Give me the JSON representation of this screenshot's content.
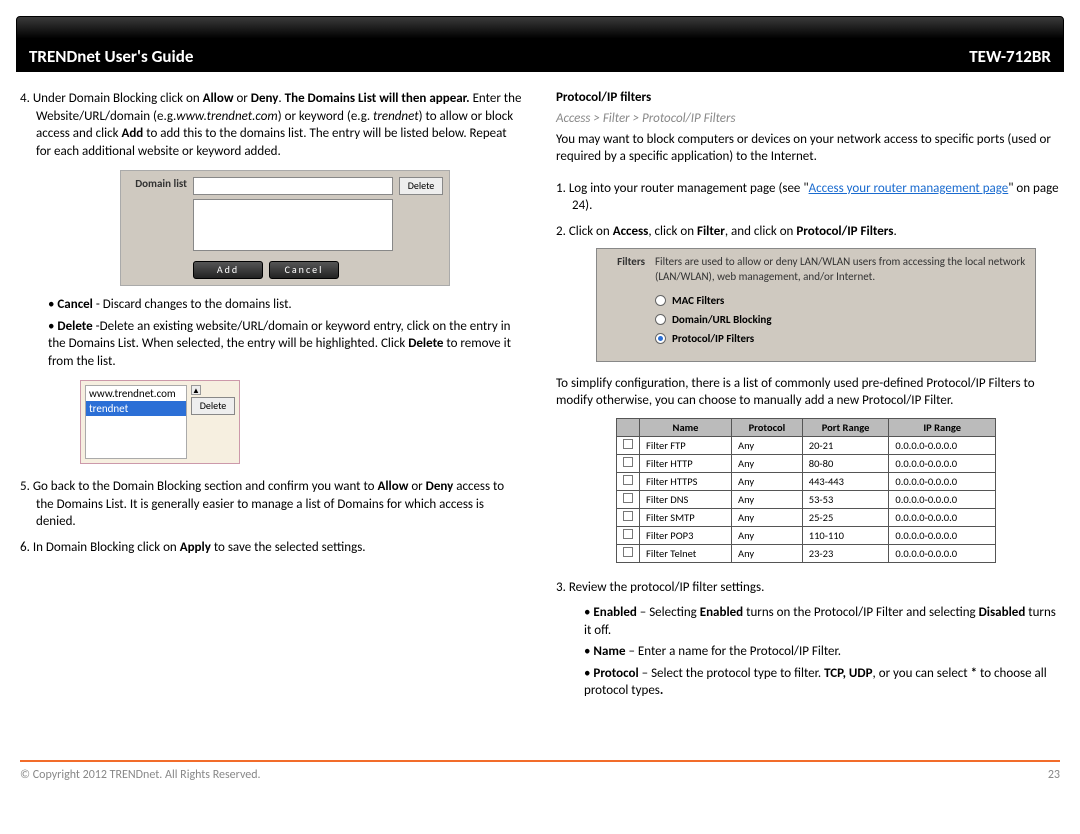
{
  "header": {
    "left": "TRENDnet User's Guide",
    "right": "TEW-712BR"
  },
  "left": {
    "step4": {
      "num": "4",
      "t1": "Under Domain Blocking click on ",
      "allow": "Allow",
      "t2": " or ",
      "deny": "Deny",
      "t3": ". ",
      "bold1": "The Domains List will then appear.",
      "t4": " Enter the Website/URL/domain (e.g.",
      "ex1": "www.trendnet.com",
      "t5": ") or keyword (e.g. ",
      "ex2": "trendnet",
      "t6": ") to allow or block access and click ",
      "add": "Add",
      "t7": " to add this to the domains list. The entry will be listed below.  Repeat for each additional website or keyword added."
    },
    "domainPanel": {
      "label": "Domain list",
      "delete": "Delete",
      "addBtn": "Add",
      "cancelBtn": "Cancel"
    },
    "bul1": {
      "cancel_b": "Cancel",
      "cancel_t": " - Discard changes to the domains list.",
      "delete_b": "Delete",
      "delete_t1": " -Delete an existing website/URL/domain or keyword entry, click on the entry in the Domains List. When selected, the entry will be highlighted. Click ",
      "delete_b2": "Delete",
      "delete_t2": " to remove it from the list."
    },
    "selPanel": {
      "item1": "www.trendnet.com",
      "item2": "trendnet",
      "delete": "Delete"
    },
    "step5": {
      "num": "5",
      "t1": "Go back to the Domain Blocking section and confirm you want to ",
      "allow": "Allow",
      "or": " or ",
      "deny": "Deny",
      "t2": " access to the Domains List. It is generally easier to manage a list of Domains for which access is denied."
    },
    "step6": {
      "num": "6",
      "t1": "In Domain Blocking click on ",
      "apply": "Apply",
      "t2": " to save the selected settings."
    }
  },
  "right": {
    "title": "Protocol/IP filters",
    "crumb": "Access > Filter > Protocol/IP Filters",
    "intro": "You may want to block computers or devices on your network access to specific ports (used or required by a specific application) to the Internet.",
    "step1": {
      "num": "1",
      "t1": "Log into your router management page (see \"",
      "link": "Access your router management page",
      "t2": "\" on page 24)."
    },
    "step2": {
      "num": "2",
      "t1": "Click on ",
      "b1": "Access",
      "t2": ", click on ",
      "b2": "Filter",
      "t3": ", and click on ",
      "b3": "Protocol/IP Filters",
      "t4": "."
    },
    "filtersPanel": {
      "label": "Filters",
      "desc": "Filters are used to allow or deny LAN/WLAN users from accessing the local network (LAN/WLAN), web management, and/or Internet.",
      "o1": "MAC Filters",
      "o2": "Domain/URL Blocking",
      "o3": "Protocol/IP Filters"
    },
    "mid": "To simplify configuration, there is a list of commonly used pre-defined Protocol/IP Filters to modify otherwise, you can choose to manually add a new Protocol/IP Filter.",
    "tbl": {
      "h1": "Name",
      "h2": "Protocol",
      "h3": "Port Range",
      "h4": "IP Range",
      "rows": [
        {
          "n": "Filter FTP",
          "p": "Any",
          "r": "20-21",
          "ip": "0.0.0.0-0.0.0.0"
        },
        {
          "n": "Filter HTTP",
          "p": "Any",
          "r": "80-80",
          "ip": "0.0.0.0-0.0.0.0"
        },
        {
          "n": "Filter HTTPS",
          "p": "Any",
          "r": "443-443",
          "ip": "0.0.0.0-0.0.0.0"
        },
        {
          "n": "Filter DNS",
          "p": "Any",
          "r": "53-53",
          "ip": "0.0.0.0-0.0.0.0"
        },
        {
          "n": "Filter SMTP",
          "p": "Any",
          "r": "25-25",
          "ip": "0.0.0.0-0.0.0.0"
        },
        {
          "n": "Filter POP3",
          "p": "Any",
          "r": "110-110",
          "ip": "0.0.0.0-0.0.0.0"
        },
        {
          "n": "Filter Telnet",
          "p": "Any",
          "r": "23-23",
          "ip": "0.0.0.0-0.0.0.0"
        }
      ]
    },
    "step3": {
      "num": "3",
      "t": "Review the protocol/IP filter settings."
    },
    "bul2": {
      "en_b": "Enabled",
      "en_t1": " – Selecting ",
      "en_b2": "Enabled",
      "en_t2": " turns on the Protocol/IP Filter and selecting ",
      "en_b3": "Disabled",
      "en_t3": " turns it off.",
      "nm_b": "Name",
      "nm_t": " – Enter a name for the Protocol/IP Filter.",
      "pr_b": "Protocol",
      "pr_t1": " – Select the protocol type to filter. ",
      "pr_b2": "TCP, UDP",
      "pr_t2": ", or you can select ",
      "pr_b3": "*",
      "pr_t3": " to choose all protocol types",
      "pr_b4": "."
    }
  },
  "footer": {
    "left": "© Copyright 2012 TRENDnet. All Rights Reserved.",
    "right": "23"
  }
}
